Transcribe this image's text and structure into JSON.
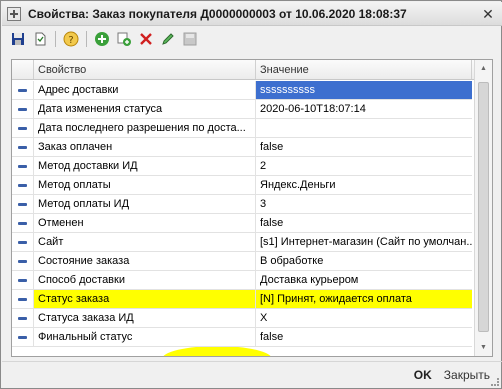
{
  "window": {
    "title": "Свойства: Заказ покупателя Д0000000003 от 10.06.2020 18:08:37",
    "close_glyph": "✕"
  },
  "toolbar": {
    "icons": [
      "save-icon",
      "document-icon",
      "help-icon",
      "add-icon",
      "copy-icon",
      "delete-icon",
      "edit-icon",
      "disk-icon"
    ]
  },
  "grid": {
    "headers": {
      "property": "Свойство",
      "value": "Значение"
    },
    "rows": [
      {
        "property": "Адрес доставки",
        "value": "ssssssssss"
      },
      {
        "property": "Дата изменения статуса",
        "value": "2020-06-10T18:07:14"
      },
      {
        "property": "Дата последнего разрешения по доста...",
        "value": ""
      },
      {
        "property": "Заказ оплачен",
        "value": "false"
      },
      {
        "property": "Метод доставки ИД",
        "value": "2"
      },
      {
        "property": "Метод оплаты",
        "value": "Яндекс.Деньги"
      },
      {
        "property": "Метод оплаты ИД",
        "value": "3"
      },
      {
        "property": "Отменен",
        "value": "false"
      },
      {
        "property": "Сайт",
        "value": "[s1] Интернет-магазин (Сайт по умолчан..."
      },
      {
        "property": "Состояние заказа",
        "value": "В обработке"
      },
      {
        "property": "Способ доставки",
        "value": "Доставка курьером"
      },
      {
        "property": "Статус заказа",
        "value": "[N] Принят, ожидается оплата"
      },
      {
        "property": "Статуса заказа ИД",
        "value": "X"
      },
      {
        "property": "Финальный статус",
        "value": "false"
      }
    ]
  },
  "footer": {
    "ok_label": "OK",
    "close_label": "Закрыть"
  },
  "colors": {
    "selection": "#3d6fcf",
    "highlight": "#ffff00",
    "row_marker": "#3a5fa8"
  }
}
